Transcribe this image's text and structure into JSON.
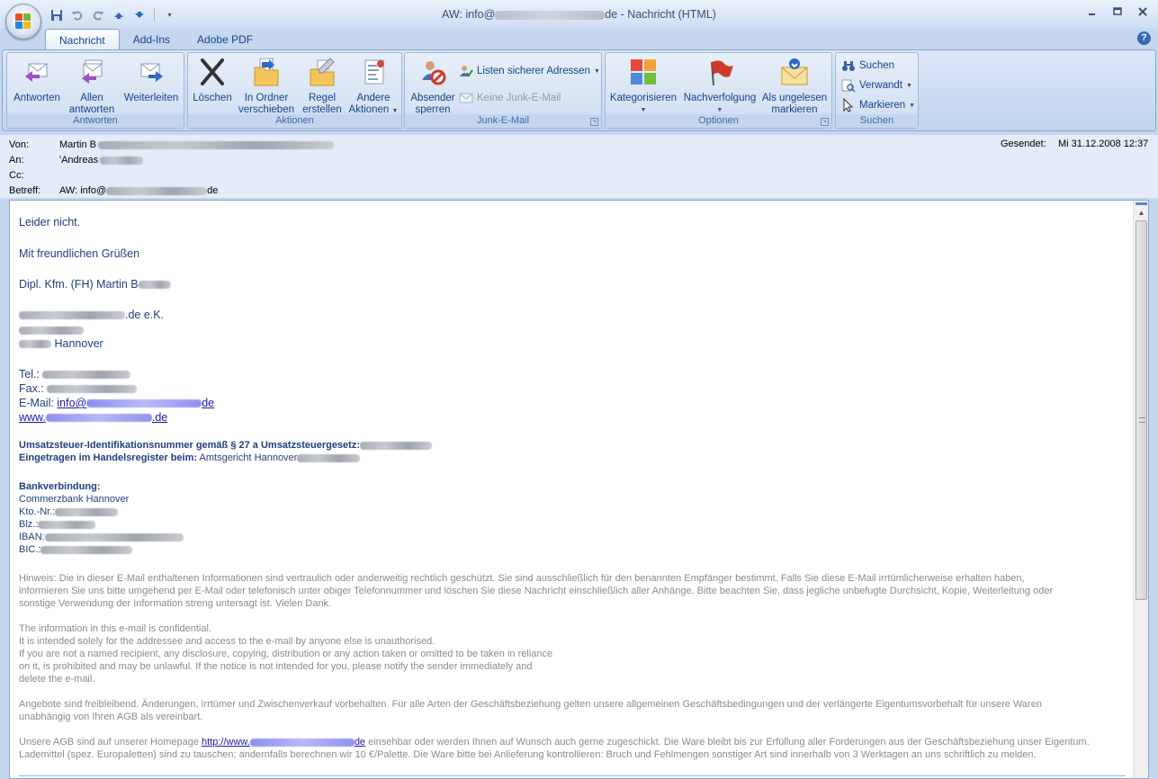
{
  "window": {
    "title_prefix": "AW: info@",
    "title_suffix": "de - Nachricht (HTML)",
    "controls": [
      "minimize",
      "maximize",
      "close"
    ]
  },
  "qat": {
    "icons": [
      "save-icon",
      "undo-icon",
      "redo-icon",
      "previous-item-icon",
      "next-item-icon",
      "customize-icon"
    ]
  },
  "tabs": [
    {
      "label": "Nachricht",
      "active": true
    },
    {
      "label": "Add-Ins",
      "active": false
    },
    {
      "label": "Adobe PDF",
      "active": false
    }
  ],
  "ribbon": {
    "antworten": {
      "label": "Antworten",
      "reply": "Antworten",
      "reply_all_1": "Allen",
      "reply_all_2": "antworten",
      "forward": "Weiterleiten"
    },
    "aktionen": {
      "label": "Aktionen",
      "delete": "Löschen",
      "move_1": "In Ordner",
      "move_2": "verschieben",
      "rule_1": "Regel",
      "rule_2": "erstellen",
      "other_1": "Andere",
      "other_2": "Aktionen"
    },
    "junk": {
      "label": "Junk-E-Mail",
      "block_1": "Absender",
      "block_2": "sperren",
      "safe_lists": "Listen sicherer Adressen",
      "not_junk": "Keine Junk-E-Mail"
    },
    "optionen": {
      "label": "Optionen",
      "categorize": "Kategorisieren",
      "followup": "Nachverfolgung",
      "unread_1": "Als ungelesen",
      "unread_2": "markieren"
    },
    "suchen": {
      "label": "Suchen",
      "find": "Suchen",
      "related": "Verwandt",
      "select": "Markieren"
    }
  },
  "header": {
    "from_label": "Von:",
    "from_value": "Martin B",
    "to_label": "An:",
    "to_value": "'Andreas",
    "cc_label": "Cc:",
    "subject_label": "Betreff:",
    "subject_prefix": "AW: info@",
    "subject_suffix": "de",
    "sent_label": "Gesendet:",
    "sent_value": "Mi 31.12.2008 12:37"
  },
  "message": {
    "line1": "Leider nicht.",
    "greeting": "Mit freundlichen Grüßen",
    "signature_name": "Dipl. Kfm. (FH) Martin B",
    "company_suffix": ".de e.K.",
    "city": "Hannover",
    "tel_label": "Tel.:",
    "fax_label": "Fax.:",
    "email_label": "E-Mail:",
    "email_prefix": "info@",
    "email_suffix": "de",
    "web_prefix": "www.",
    "web_suffix": ".de",
    "vat_label": "Umsatzsteuer-Identifikationsnummer gemäß § 27 a Umsatzsteuergesetz:",
    "register_label": "Eingetragen im Handelsregister beim:",
    "register_value": "Amtsgericht Hannover",
    "bank_heading": "Bankverbindung:",
    "bank_name": "Commerzbank Hannover",
    "kto_label": "Kto.-Nr.:",
    "blz_label": "Blz.:",
    "iban_label": "IBAN:",
    "bic_label": "BIC.:",
    "notice_de_1": "Hinweis: Die in dieser E-Mail enthaltenen Informationen sind vertraulich oder anderweitig rechtlich geschützt. Sie sind ausschließlich für den benannten Empfänger bestimmt. Falls Sie diese E-Mail irrtümlicherweise erhalten haben,",
    "notice_de_2": "informieren Sie uns bitte umgehend per E-Mail oder telefonisch unter obiger Telefonnummer und löschen Sie diese Nachricht einschließlich aller Anhänge. Bitte beachten Sie, dass jegliche unbefugte Durchsicht, Kopie, Weiterleitung oder",
    "notice_de_3": "sonstige Verwendung der Information streng untersagt ist. Vielen Dank.",
    "notice_en_1": "The information in this e-mail is confidential.",
    "notice_en_2": "It is intended solely for the addressee and access to the e-mail by anyone else is unauthorised.",
    "notice_en_3": "If you are not a named recipient, any disclosure, copying, distribution or any action taken or omitted to be taken in reliance",
    "notice_en_4": "on it, is prohibited and may be unlawful. If the notice is not intended for you, please notify the sender immediately and",
    "notice_en_5": "delete the e-mail.",
    "offers_1": "Angebote sind freibleibend. Änderungen, Irrtümer und Zwischenverkauf vorbehalten. Für alle Arten der Geschäftsbeziehung gelten unsere allgemeinen Geschäftsbedingungen und der verlängerte Eigentumsvorbehalt für unsere Waren",
    "offers_2": "unabhängig von Ihren AGB als vereinbart.",
    "agb_1_prefix": "Unsere AGB sind auf unserer Homepage",
    "agb_link_prefix": "http://www.",
    "agb_link_suffix": "de",
    "agb_1_suffix": "einsehbar oder werden Ihnen auf Wunsch auch gerne zugeschickt. Die Ware bleibt bis zur Erfüllung aller Forderungen aus der Geschäftsbeziehung unser Eigentum.",
    "agb_2": "Lademittel (spez. Europaletten) sind zu tauschen; andernfalls berechnen wir 10 €/Palette. Die Ware bitte bei Anlieferung kontrollieren: Bruch und Fehlmengen sonstiger Art sind innerhalb von 3 Werktagen an uns schriftlich zu melden."
  },
  "colors": {
    "ribbon_bg": "#cbdcf1",
    "accent_text": "#15428b",
    "link": "#1a1aa6",
    "disclaimer_grey": "#8b8b8b"
  }
}
